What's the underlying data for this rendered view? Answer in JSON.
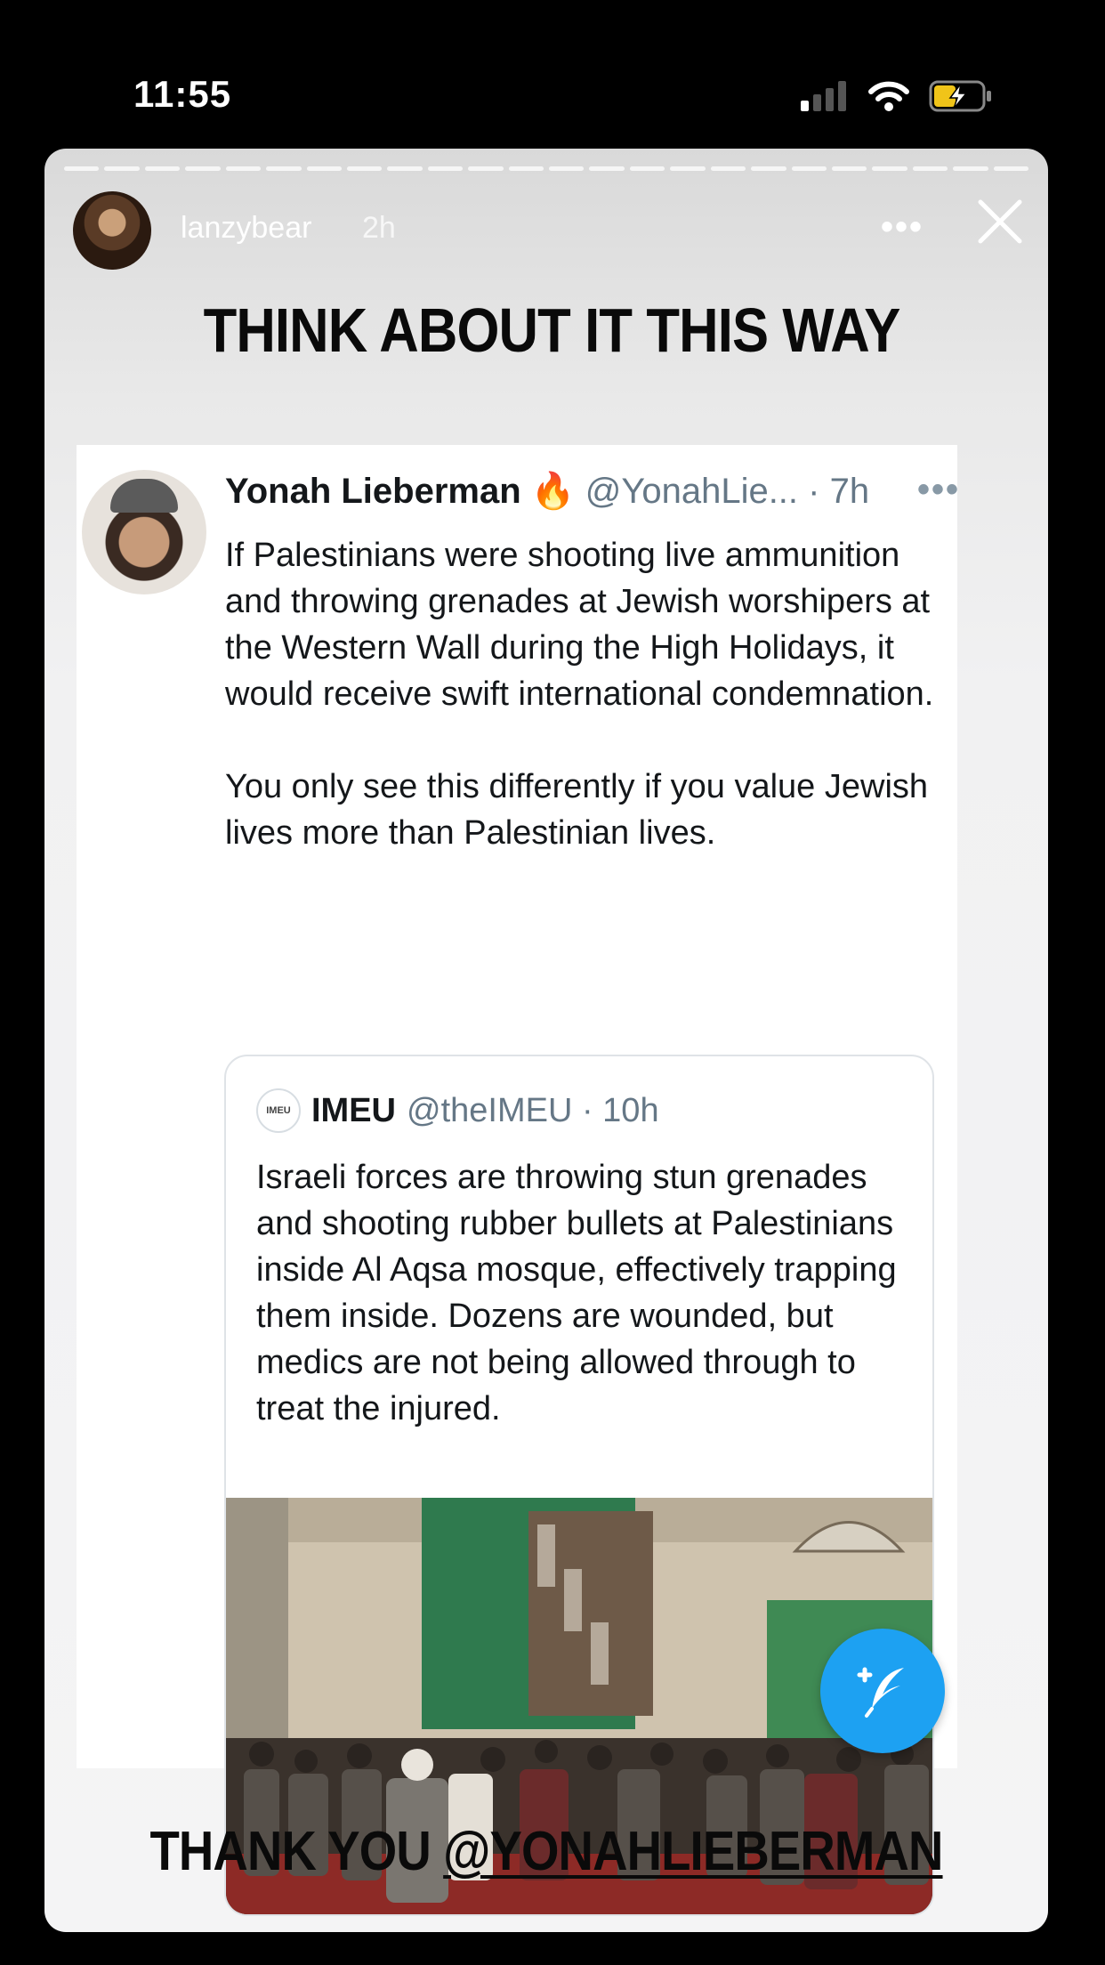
{
  "status_bar": {
    "time": "11:55"
  },
  "story": {
    "username": "lanzybear",
    "time_ago": "2h",
    "more_label": "•••",
    "headline": "THINK ABOUT IT THIS WAY",
    "footer_prefix": "THANK YOU ",
    "footer_mention": "@YONAHLIEBERMAN"
  },
  "tweet": {
    "name": "Yonah Lieberman",
    "emoji": "🔥",
    "handle_time": "@YonahLie... · 7h",
    "more_label": "•••",
    "paragraph1": "If Palestinians were shooting live ammunition and throwing grenades at Jewish worshipers at the Western Wall during the High Holidays, it would receive swift international condemnation.",
    "paragraph2": "You only see this differently if you value Jewish lives more than Palestinian lives."
  },
  "quote": {
    "logo_text": "IMEU",
    "name": "IMEU",
    "handle_time": "@theIMEU · 10h",
    "text": "Israeli forces are throwing stun grenades and shooting rubber bullets at Palestinians inside Al Aqsa mosque, effectively trapping them inside. Dozens are wounded, but medics are not being allowed through to treat the injured."
  },
  "colors": {
    "twitter_blue": "#1da1f2",
    "handle_gray": "#657786",
    "text_dark": "#14171a"
  },
  "icons": [
    "signal-icon",
    "wifi-icon",
    "battery-charging-icon",
    "close-icon",
    "compose-tweet-icon"
  ]
}
